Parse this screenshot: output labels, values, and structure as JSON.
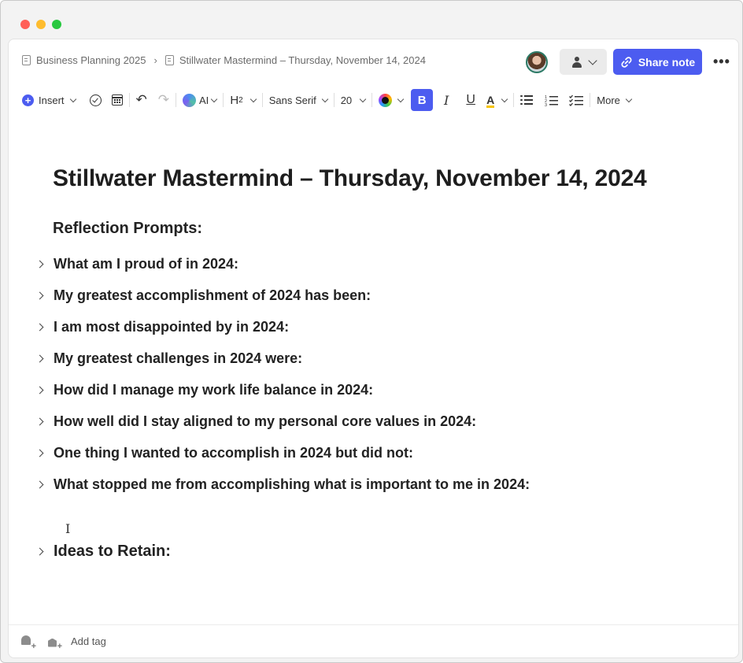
{
  "breadcrumbs": {
    "root": "Business Planning 2025",
    "current": "Stillwater Mastermind – Thursday, November 14, 2024"
  },
  "header": {
    "share_label": "Share note",
    "more_label": "•••"
  },
  "toolbar": {
    "insert_label": "Insert",
    "ai_label": "AI",
    "heading_label": "H",
    "heading_level": "2",
    "font_label": "Sans Serif",
    "size_label": "20",
    "bold_label": "B",
    "italic_label": "I",
    "underline_label": "U",
    "highlight_label": "A",
    "more_label": "More",
    "undo_glyph": "↶",
    "redo_glyph": "↷",
    "accent_color": "#4c5cf0"
  },
  "document": {
    "title": "Stillwater Mastermind – Thursday, November 14, 2024",
    "section_heading": "Reflection Prompts:",
    "prompts": [
      "What am I proud of in 2024:",
      "My greatest accomplishment of 2024 has been:",
      "I am most disappointed by in 2024:",
      "My greatest challenges in 2024 were:",
      "How did I manage my work life balance in 2024:",
      "How well did I stay aligned to my personal core values in 2024:",
      "One thing I wanted to accomplish in 2024 but did not:",
      "What stopped me from accomplishing what is important to me in 2024:"
    ],
    "ideas_heading": "Ideas to Retain:"
  },
  "footer": {
    "add_tag_label": "Add tag"
  }
}
